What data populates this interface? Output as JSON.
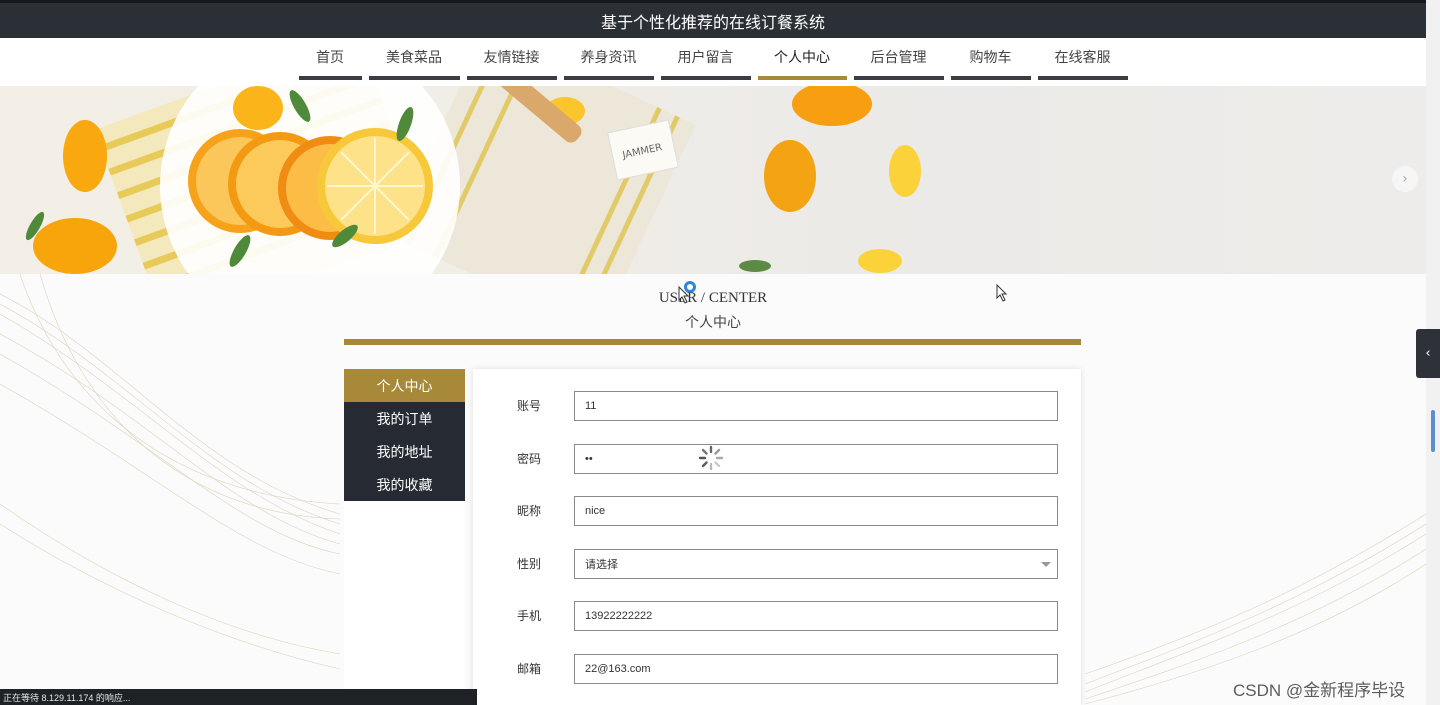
{
  "app": {
    "title": "基于个性化推荐的在线订餐系统"
  },
  "nav": {
    "items": [
      {
        "label": "首页"
      },
      {
        "label": "美食菜品"
      },
      {
        "label": "友情链接"
      },
      {
        "label": "养身资讯"
      },
      {
        "label": "用户留言"
      },
      {
        "label": "个人中心"
      },
      {
        "label": "后台管理"
      },
      {
        "label": "购物车"
      },
      {
        "label": "在线客服"
      }
    ],
    "active": "个人中心"
  },
  "banner": {
    "next_icon": "chevron-right-icon",
    "brand_text": "JAMMER"
  },
  "section": {
    "title_en": "USER / CENTER",
    "title_zh": "个人中心"
  },
  "side_menu": {
    "items": [
      {
        "label": "个人中心"
      },
      {
        "label": "我的订单"
      },
      {
        "label": "我的地址"
      },
      {
        "label": "我的收藏"
      }
    ],
    "active": "个人中心"
  },
  "form": {
    "account": {
      "label": "账号",
      "value": "11"
    },
    "password": {
      "label": "密码",
      "value": "••"
    },
    "nickname": {
      "label": "昵称",
      "value": "nice"
    },
    "gender": {
      "label": "性别",
      "value": "请选择"
    },
    "phone": {
      "label": "手机",
      "value": "13922222222"
    },
    "email": {
      "label": "邮箱",
      "value": "22@163.com"
    }
  },
  "status_bar": {
    "text": "正在等待 8.129.11.174 的响应..."
  },
  "watermark": {
    "text": "CSDN @金新程序毕设"
  },
  "colors": {
    "accent_gold": "#a8893a",
    "dark": "#262b33",
    "topbar": "#2b2f36"
  }
}
